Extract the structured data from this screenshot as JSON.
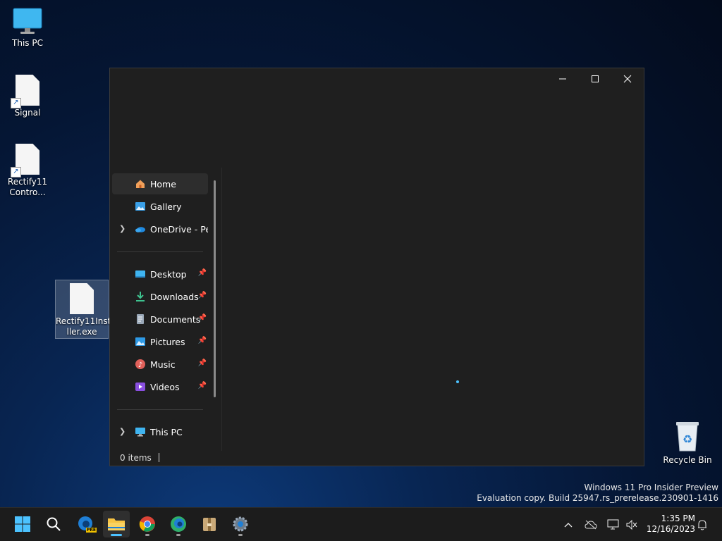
{
  "desktop": {
    "icons": [
      {
        "label": "This PC"
      },
      {
        "label": "Signal"
      },
      {
        "label_line1": "Rectify11",
        "label_line2": "Contro..."
      },
      {
        "label_line1": "Rectify11Insta",
        "label_line2": "ller.exe"
      },
      {
        "label": "Recycle Bin"
      }
    ]
  },
  "explorer": {
    "nav": [
      {
        "label": "Home"
      },
      {
        "label": "Gallery"
      },
      {
        "label": "OneDrive - Personal"
      },
      {
        "label": "Desktop"
      },
      {
        "label": "Downloads"
      },
      {
        "label": "Documents"
      },
      {
        "label": "Pictures"
      },
      {
        "label": "Music"
      },
      {
        "label": "Videos"
      },
      {
        "label": "This PC"
      }
    ],
    "status": "0 items"
  },
  "watermark": {
    "line1": "Windows 11 Pro Insider Preview",
    "line2": "Evaluation copy. Build 25947.rs_prerelease.230901-1416"
  },
  "taskbar": {
    "pinned": [
      "start-icon",
      "search-icon",
      "edge-beta-icon",
      "file-explorer-icon",
      "chrome-icon",
      "edge-icon",
      "archive-icon",
      "settings-icon"
    ],
    "edge_beta_badge": "PRE",
    "time": "1:35 PM",
    "date": "12/16/2023"
  },
  "colors": {
    "accent": "#4cc2ff",
    "window_bg": "#1f1f1f",
    "taskbar_bg": "#1c1c1c"
  }
}
